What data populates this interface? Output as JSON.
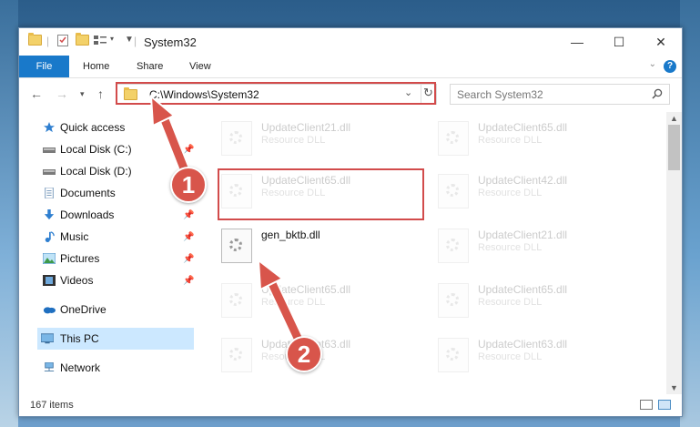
{
  "window": {
    "title": "System32",
    "controls": {
      "minimize": "—",
      "maximize": "☐",
      "close": "✕"
    }
  },
  "ribbon": {
    "tabs": [
      "File",
      "Home",
      "Share",
      "View"
    ],
    "help": "?"
  },
  "navigation": {
    "address": "C:\\Windows\\System32",
    "search_placeholder": "Search System32"
  },
  "sidebar": {
    "items": [
      {
        "label": "Quick access",
        "icon": "star-icon"
      },
      {
        "label": "Local Disk (C:)",
        "icon": "drive-icon",
        "pinned": true
      },
      {
        "label": "Local Disk (D:)",
        "icon": "drive-icon"
      },
      {
        "label": "Documents",
        "icon": "documents-icon"
      },
      {
        "label": "Downloads",
        "icon": "download-icon",
        "pinned": true
      },
      {
        "label": "Music",
        "icon": "music-icon",
        "pinned": true
      },
      {
        "label": "Pictures",
        "icon": "pictures-icon",
        "pinned": true
      },
      {
        "label": "Videos",
        "icon": "videos-icon",
        "pinned": true
      },
      {
        "label": "OneDrive",
        "icon": "cloud-icon"
      },
      {
        "label": "This PC",
        "icon": "computer-icon",
        "selected": true
      },
      {
        "label": "Network",
        "icon": "network-icon"
      }
    ]
  },
  "files": {
    "left": [
      {
        "name": "UpdateClient21.dll",
        "type": "Resource DLL"
      },
      {
        "name": "UpdateClient65.dll",
        "type": "Resource DLL"
      },
      {
        "name": "gen_bktb.dll",
        "type": ""
      },
      {
        "name": "UpdateClient65.dll",
        "type": "Resource DLL"
      },
      {
        "name": "UpdateClient63.dll",
        "type": "Resource DLL"
      }
    ],
    "right": [
      {
        "name": "UpdateClient65.dll",
        "type": "Resource DLL"
      },
      {
        "name": "UpdateClient42.dll",
        "type": "Resource DLL"
      },
      {
        "name": "UpdateClient21.dll",
        "type": "Resource DLL"
      },
      {
        "name": "UpdateClient65.dll",
        "type": "Resource DLL"
      },
      {
        "name": "UpdateClient63.dll",
        "type": "Resource DLL"
      }
    ]
  },
  "status": {
    "item_count": "167 items"
  },
  "annotations": {
    "step1": "1",
    "step2": "2"
  },
  "colors": {
    "accent": "#1979ca",
    "highlight_box": "#d24b4b",
    "arrow": "#d8554b"
  }
}
